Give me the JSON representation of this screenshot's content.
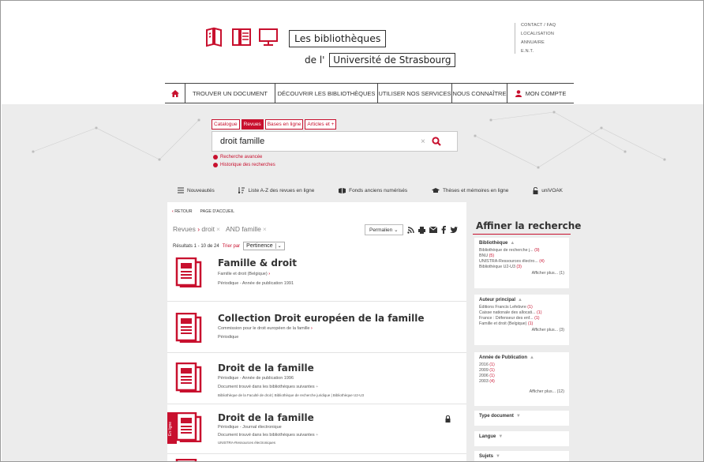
{
  "header": {
    "logo_title": "Les bibliothèques",
    "logo_prefix": "de l'",
    "logo_univ": "Université de Strasbourg",
    "top_links": [
      "CONTACT / FAQ",
      "LOCALISATION",
      "ANNUAIRE",
      "E.N.T."
    ]
  },
  "nav": {
    "items": [
      "TROUVER UN DOCUMENT",
      "DÉCOUVRIR LES BIBLIOTHÈQUES",
      "UTILISER NOS SERVICES",
      "NOUS CONNAÎTRE",
      "MON COMPTE"
    ]
  },
  "search": {
    "tabs": [
      "Catalogue",
      "Revues",
      "Bases en ligne",
      "Articles et +"
    ],
    "active_tab": "Revues",
    "query": "droit famille",
    "advanced": "Recherche avancée",
    "history": "Historique des recherches"
  },
  "quicklinks": [
    "Nouveautés",
    "Liste A-Z des revues en ligne",
    "Fonds anciens numérisés",
    "Thèses et mémoires en ligne",
    "uniVOAK"
  ],
  "results": {
    "back": "RETOUR",
    "home": "PAGE D'ACCUEIL",
    "filter_root": "Revues",
    "filter_1": "droit",
    "filter_2": "AND famille",
    "permalink": "Permalien",
    "count_text": "Résultats 1 - 10 de 24",
    "sort_label": "Trier par",
    "sort_value": "Pertinence",
    "items": [
      {
        "title": "Famille & droit",
        "line1": "Famille et droit (Belgique)",
        "line2": "Périodique - Année de publication 1991",
        "line3": "",
        "line4": ""
      },
      {
        "title": "Collection Droit européen de la famille",
        "line1": "Commission pour le droit européen de la famille",
        "line2": "Périodique",
        "line3": "",
        "line4": ""
      },
      {
        "title": "Droit de la famille",
        "line1": "Périodique - Année de publication 1996",
        "line2": "Document trouvé dans les bibliothèques suivantes",
        "line3": "Bibliothèque de la Faculté de droit | Bibliothèque de recherche juridique | Bibliothèque U2-U3",
        "line4": ""
      },
      {
        "title": "Droit de la famille",
        "line1": "Périodique - Journal électronique",
        "line2": "Document trouvé dans les bibliothèques suivantes",
        "line3": "UNISTRA-Ressources électroniques",
        "line4": "En ligne"
      }
    ]
  },
  "sidebar": {
    "title": "Affiner la recherche",
    "facets": [
      {
        "name": "Bibliothèque",
        "rows": [
          [
            "Bibliothèque de recherche j...",
            "(9)"
          ],
          [
            "BNU",
            "(5)"
          ],
          [
            "UNISTRA-Ressources électro...",
            "(4)"
          ],
          [
            "Bibliothèque U2-U3",
            "(3)"
          ]
        ],
        "more": "Afficher plus... (1)"
      },
      {
        "name": "Auteur principal",
        "rows": [
          [
            "Éditions Francis Lefebvre",
            "(1)"
          ],
          [
            "Caisse nationale des allocati...",
            "(1)"
          ],
          [
            "France : Défenseur des enf...",
            "(1)"
          ],
          [
            "Famille et droit (Belgique)",
            "(1)"
          ]
        ],
        "more": "Afficher plus... (3)"
      },
      {
        "name": "Année de Publication",
        "rows": [
          [
            "2016",
            "(1)"
          ],
          [
            "2009",
            "(1)"
          ],
          [
            "2006",
            "(1)"
          ],
          [
            "2003",
            "(4)"
          ]
        ],
        "more": "Afficher plus... (12)"
      },
      {
        "name": "Type document",
        "rows": [],
        "more": ""
      },
      {
        "name": "Langue",
        "rows": [],
        "more": ""
      },
      {
        "name": "Sujets",
        "rows": [],
        "more": ""
      }
    ]
  },
  "colors": {
    "accent": "#c8102e",
    "background": "#ececec"
  }
}
